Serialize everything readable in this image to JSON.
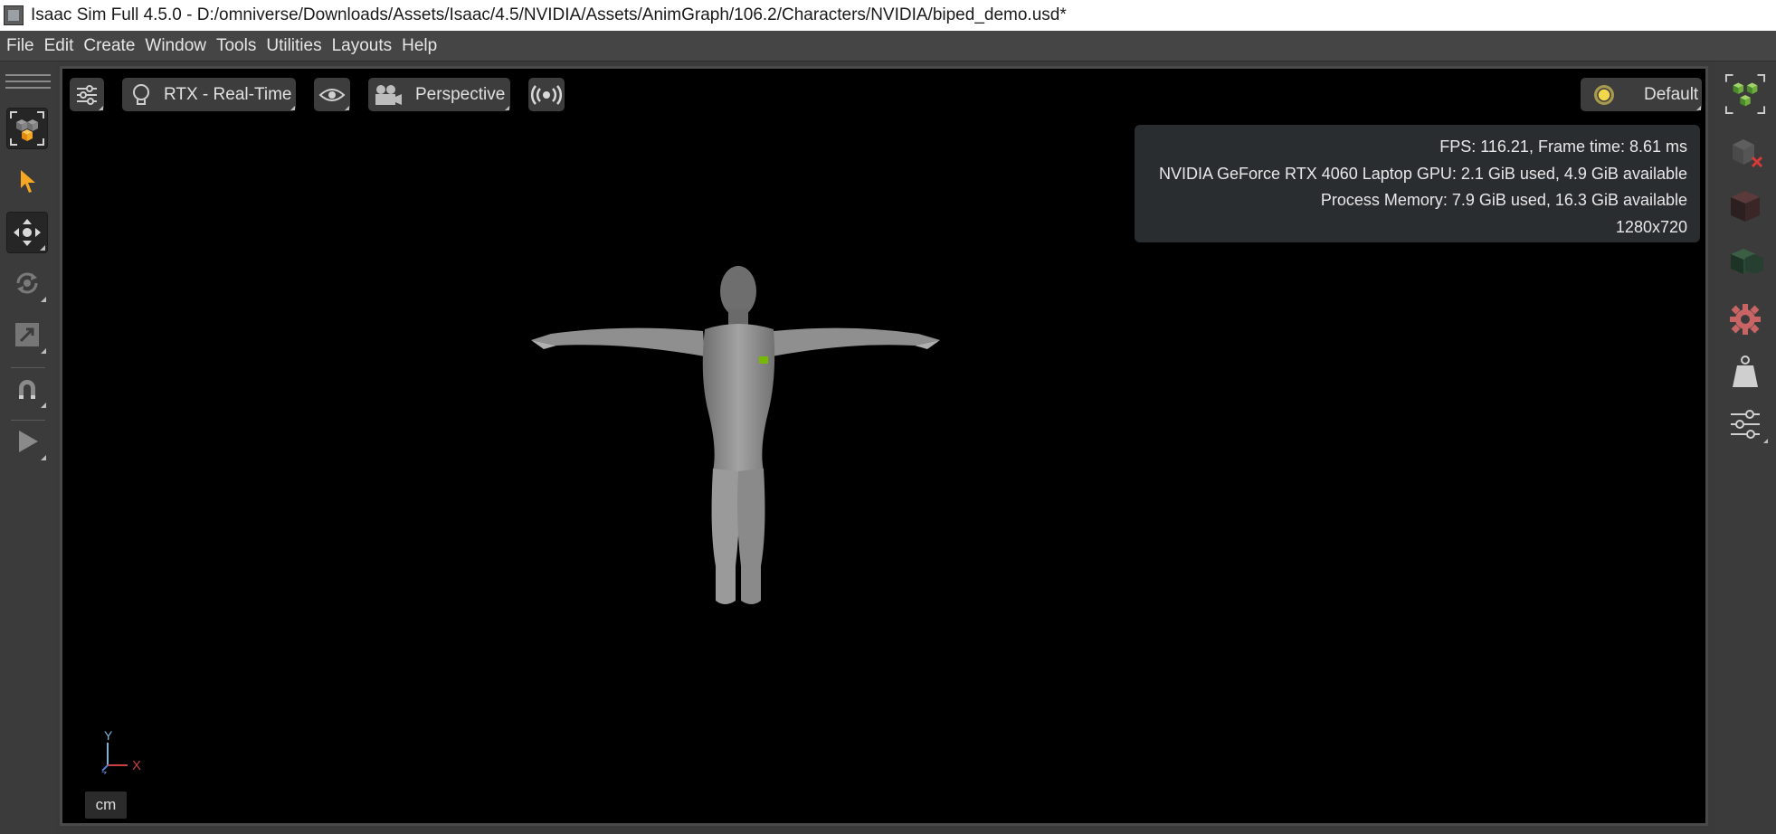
{
  "window": {
    "title": "Isaac Sim Full 4.5.0 - D:/omniverse/Downloads/Assets/Isaac/4.5/NVIDIA/Assets/AnimGraph/106.2/Characters/NVIDIA/biped_demo.usd*",
    "app_icon": "isaac-sim-app-icon"
  },
  "menu": [
    "File",
    "Edit",
    "Create",
    "Window",
    "Tools",
    "Utilities",
    "Layouts",
    "Help"
  ],
  "left_toolbar": {
    "tools": [
      {
        "name": "selection-mode",
        "icon": "cube-select-icon",
        "active": true
      },
      {
        "name": "select",
        "icon": "arrow-pointer-icon"
      },
      {
        "name": "move",
        "icon": "move-arrows-icon",
        "active": true
      },
      {
        "name": "rotate",
        "icon": "rotate-icon"
      },
      {
        "name": "scale",
        "icon": "scale-icon"
      },
      {
        "name": "snap",
        "icon": "magnet-icon"
      },
      {
        "name": "play",
        "icon": "play-icon"
      }
    ]
  },
  "viewport": {
    "settings_icon": "sliders-icon",
    "renderer_label": "RTX - Real-Time",
    "renderer_icon": "lightbulb-icon",
    "visibility_icon": "eye-icon",
    "camera_label": "Perspective",
    "camera_icon": "camera-icon",
    "stream_icon": "broadcast-icon",
    "lighting_label": "Default",
    "lighting_icon": "sun-icon",
    "stats": {
      "fps": "FPS: 116.21, Frame time: 8.61 ms",
      "gpu": "NVIDIA GeForce RTX 4060 Laptop GPU: 2.1 GiB used, 4.9 GiB available",
      "memory": "Process Memory: 7.9 GiB used, 16.3 GiB available",
      "resolution": "1280x720"
    },
    "axis": {
      "y": "Y",
      "x": "X",
      "z": "Z"
    },
    "unit": "cm",
    "character": "biped-character-mesh"
  },
  "right_toolbar": {
    "tools": [
      {
        "name": "stage-selection",
        "icon": "cubes-select-icon"
      },
      {
        "name": "hide-unselected",
        "icon": "cube-x-icon"
      },
      {
        "name": "dark-cube",
        "icon": "dark-cube-icon"
      },
      {
        "name": "stack-cubes",
        "icon": "green-cubes-icon"
      },
      {
        "name": "settings",
        "icon": "gear-icon"
      },
      {
        "name": "mass",
        "icon": "weight-icon"
      },
      {
        "name": "properties",
        "icon": "sliders-icon"
      }
    ]
  },
  "colors": {
    "accent_orange": "#f5a623",
    "nvidia_green": "#76b900",
    "axis_x": "#c84040",
    "axis_y": "#7fb3d5",
    "gear": "#c86464"
  }
}
